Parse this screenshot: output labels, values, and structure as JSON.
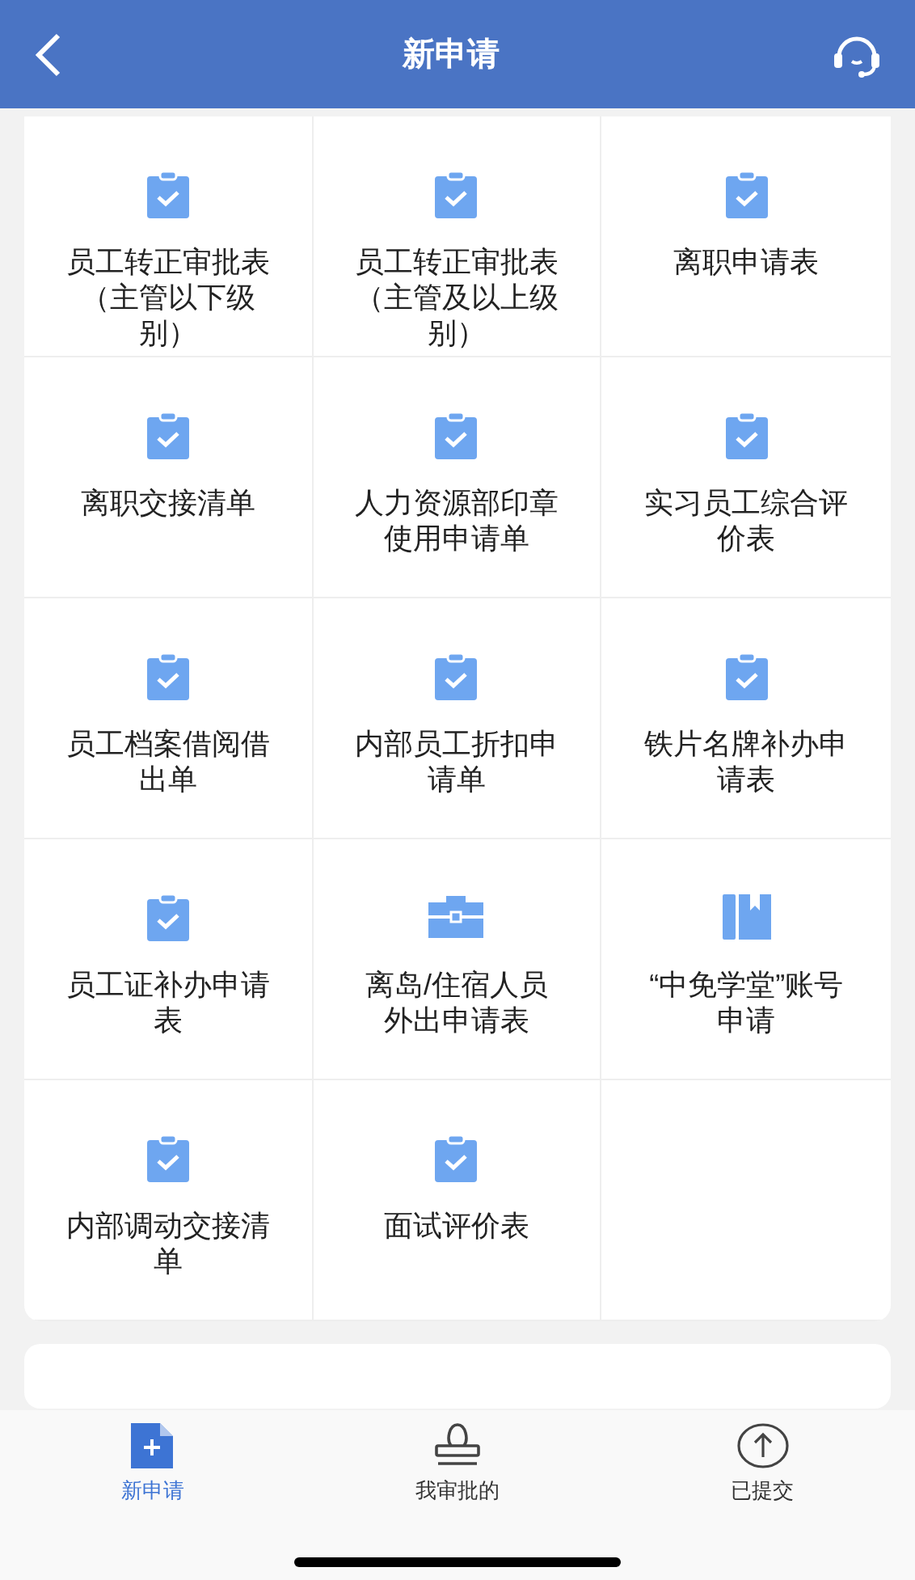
{
  "header": {
    "title": "新申请"
  },
  "forms": [
    {
      "label": "员工转正审批表（主管以下级别）",
      "kind": "clipboard"
    },
    {
      "label": "员工转正审批表（主管及以上级别）",
      "kind": "clipboard"
    },
    {
      "label": "离职申请表",
      "kind": "clipboard"
    },
    {
      "label": "离职交接清单",
      "kind": "clipboard"
    },
    {
      "label": "人力资源部印章使用申请单",
      "kind": "clipboard"
    },
    {
      "label": "实习员工综合评价表",
      "kind": "clipboard"
    },
    {
      "label": "员工档案借阅借出单",
      "kind": "clipboard"
    },
    {
      "label": "内部员工折扣申请单",
      "kind": "clipboard"
    },
    {
      "label": "铁片名牌补办申请表",
      "kind": "clipboard"
    },
    {
      "label": "员工证补办申请表",
      "kind": "clipboard"
    },
    {
      "label": "离岛/住宿人员外出申请表",
      "kind": "briefcase"
    },
    {
      "label": "“中免学堂”账号申请",
      "kind": "book"
    },
    {
      "label": "内部调动交接清单",
      "kind": "clipboard"
    },
    {
      "label": "面试评价表",
      "kind": "clipboard"
    }
  ],
  "tabs": [
    {
      "label": "新申请",
      "kind": "new",
      "selected": true
    },
    {
      "label": "我审批的",
      "kind": "stamp",
      "selected": false
    },
    {
      "label": "已提交",
      "kind": "submitted",
      "selected": false
    }
  ]
}
